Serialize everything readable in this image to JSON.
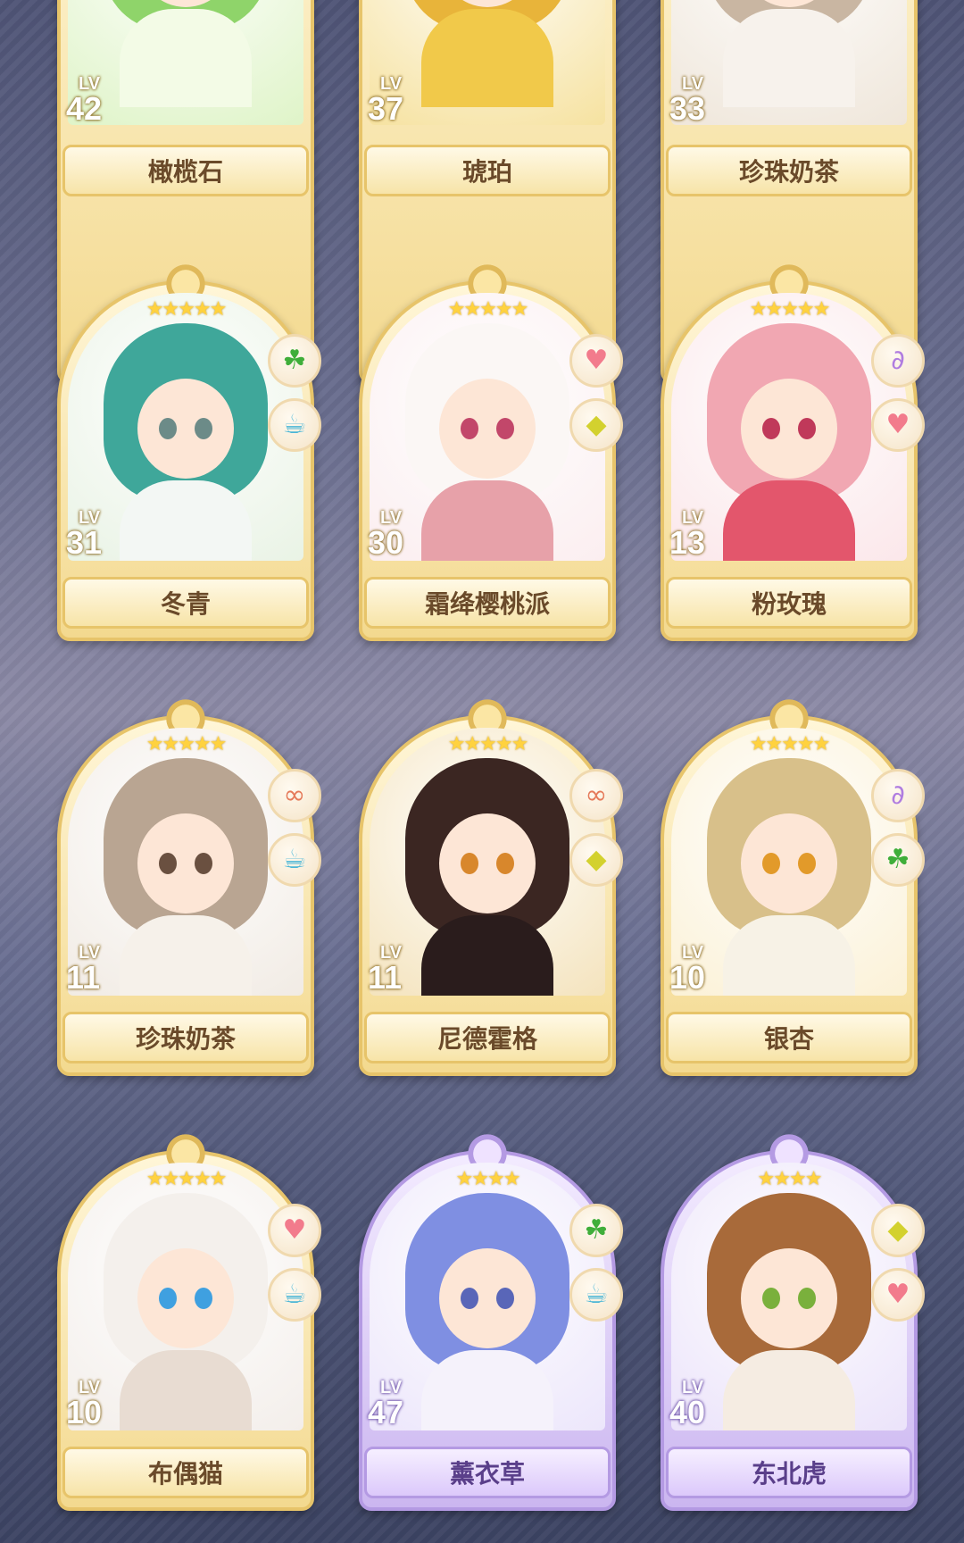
{
  "cards": [
    {
      "name": "橄榄石",
      "level": "42",
      "lv": "LV",
      "stars": "",
      "frame": "gold",
      "traits": [],
      "colors": {
        "bg": "#dff4c8",
        "hair": "#8fd46a",
        "body": "#f3fbe6",
        "eye": "#6aa84f"
      }
    },
    {
      "name": "琥珀",
      "level": "37",
      "lv": "LV",
      "stars": "",
      "frame": "gold",
      "traits": [],
      "colors": {
        "bg": "#f6e2a0",
        "hair": "#e8b43a",
        "body": "#f1c94a",
        "eye": "#c27a12"
      }
    },
    {
      "name": "珍珠奶茶",
      "level": "33",
      "lv": "LV",
      "stars": "",
      "frame": "gold",
      "traits": [],
      "colors": {
        "bg": "#efe6da",
        "hair": "#c9b6a2",
        "body": "#f7f2ec",
        "eye": "#7b5a44"
      }
    },
    {
      "name": "冬青",
      "level": "31",
      "lv": "LV",
      "stars": "★★★★★",
      "frame": "gold",
      "traits": [
        "clover-icon",
        "teacup-icon"
      ],
      "colors": {
        "bg": "#e9f3e5",
        "hair": "#3fa79a",
        "body": "#f3f7f4",
        "eye": "#6c8b88"
      }
    },
    {
      "name": "霜绛樱桃派",
      "level": "30",
      "lv": "LV",
      "stars": "★★★★★",
      "frame": "gold",
      "traits": [
        "heart-icon",
        "gem-icon"
      ],
      "colors": {
        "bg": "#fbeef0",
        "hair": "#fbf7f5",
        "body": "#e7a1a9",
        "eye": "#c2476a"
      }
    },
    {
      "name": "粉玫瑰",
      "level": "13",
      "lv": "LV",
      "stars": "★★★★★",
      "frame": "gold",
      "traits": [
        "swan-icon",
        "heart-icon"
      ],
      "colors": {
        "bg": "#fbe7ea",
        "hair": "#f1a7b2",
        "body": "#e3566c",
        "eye": "#c0395a"
      }
    },
    {
      "name": "珍珠奶茶",
      "level": "11",
      "lv": "LV",
      "stars": "★★★★★",
      "frame": "gold",
      "traits": [
        "glasses-icon",
        "teacup-icon"
      ],
      "colors": {
        "bg": "#f1ebe4",
        "hair": "#b9a592",
        "body": "#f6f1ea",
        "eye": "#6a5040"
      }
    },
    {
      "name": "尼德霍格",
      "level": "11",
      "lv": "LV",
      "stars": "★★★★★",
      "frame": "gold",
      "traits": [
        "glasses-icon",
        "gem-icon"
      ],
      "colors": {
        "bg": "#f4e3bd",
        "hair": "#3b2622",
        "body": "#2a1c1c",
        "eye": "#d8872c"
      }
    },
    {
      "name": "银杏",
      "level": "10",
      "lv": "LV",
      "stars": "★★★★★",
      "frame": "gold",
      "traits": [
        "swan-icon",
        "clover-icon"
      ],
      "colors": {
        "bg": "#fbf1d6",
        "hair": "#d8c08a",
        "body": "#f7f2e6",
        "eye": "#e29a2a"
      }
    },
    {
      "name": "布偶猫",
      "level": "10",
      "lv": "LV",
      "stars": "★★★★★",
      "frame": "gold",
      "traits": [
        "heart-icon",
        "teacup-icon"
      ],
      "colors": {
        "bg": "#f3eeea",
        "hair": "#f4f0ec",
        "body": "#e8dcd2",
        "eye": "#3fa0e0"
      }
    },
    {
      "name": "薰衣草",
      "level": "47",
      "lv": "LV",
      "stars": "★★★★",
      "frame": "purple",
      "traits": [
        "clover-icon",
        "teacup-icon"
      ],
      "colors": {
        "bg": "#ece6fb",
        "hair": "#7f8fe2",
        "body": "#f5f2fb",
        "eye": "#5966b8"
      }
    },
    {
      "name": "东北虎",
      "level": "40",
      "lv": "LV",
      "stars": "★★★★",
      "frame": "purple",
      "traits": [
        "gem-icon",
        "heart-icon"
      ],
      "colors": {
        "bg": "#ebe3fa",
        "hair": "#a86a3a",
        "body": "#f5ece2",
        "eye": "#7ab03c"
      }
    }
  ],
  "trait_glyphs": {
    "clover-icon": "☘",
    "teacup-icon": "☕",
    "heart-icon": "♥",
    "gem-icon": "◆",
    "swan-icon": "∂",
    "glasses-icon": "∞"
  },
  "trait_colors": {
    "clover-icon": "#3fae3a",
    "teacup-icon": "#4bb6d6",
    "heart-icon": "#f27b8c",
    "gem-icon": "#d3d12e",
    "swan-icon": "#b07de0",
    "glasses-icon": "#e57a5a"
  }
}
